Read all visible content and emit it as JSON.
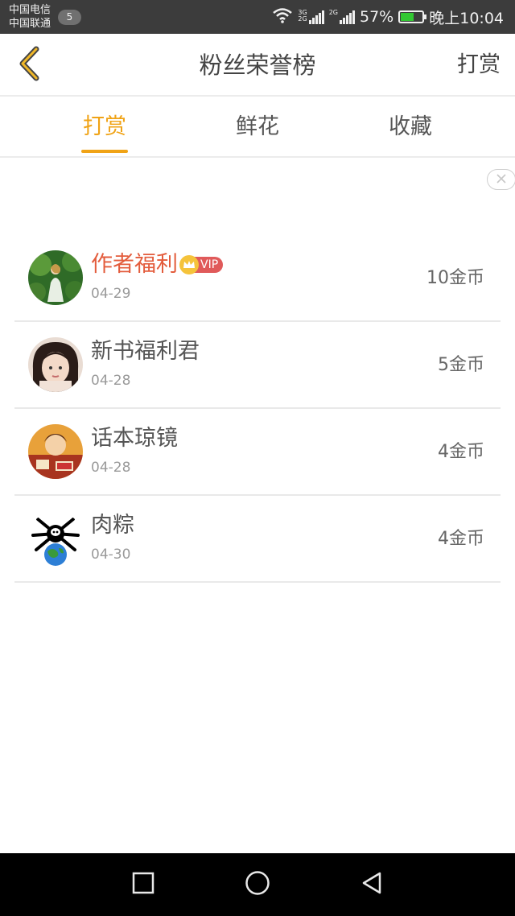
{
  "status_bar": {
    "carrier_1": "中国电信",
    "carrier_2": "中国联通",
    "notification_count": "5",
    "net_type_1": "3G",
    "net_type_1b": "2G",
    "net_type_2": "2G",
    "battery_percent": "57%",
    "battery_level": 0.57,
    "time": "晚上10:04"
  },
  "header": {
    "back_icon": "chevron-left-icon",
    "title": "粉丝荣誉榜",
    "action_label": "打赏"
  },
  "tabs": [
    {
      "label": "打赏",
      "active": true
    },
    {
      "label": "鲜花",
      "active": false
    },
    {
      "label": "收藏",
      "active": false
    }
  ],
  "accent_color": "#f0a316",
  "highlight_color": "#e35c3c",
  "vip_label": "VIP",
  "fans": [
    {
      "name": "作者福利",
      "date": "04-29",
      "coins": "10金币",
      "vip": true,
      "avatar_icon": "avatar-girl-forest"
    },
    {
      "name": "新书福利君",
      "date": "04-28",
      "coins": "5金币",
      "vip": false,
      "avatar_icon": "avatar-girl-portrait"
    },
    {
      "name": "话本琼镜",
      "date": "04-28",
      "coins": "4金币",
      "vip": false,
      "avatar_icon": "avatar-illustration"
    },
    {
      "name": "肉粽",
      "date": "04-30",
      "coins": "4金币",
      "vip": false,
      "avatar_icon": "avatar-spider-globe"
    }
  ],
  "system_nav": {
    "recent_icon": "square-icon",
    "home_icon": "circle-icon",
    "back_icon": "triangle-back-icon"
  }
}
